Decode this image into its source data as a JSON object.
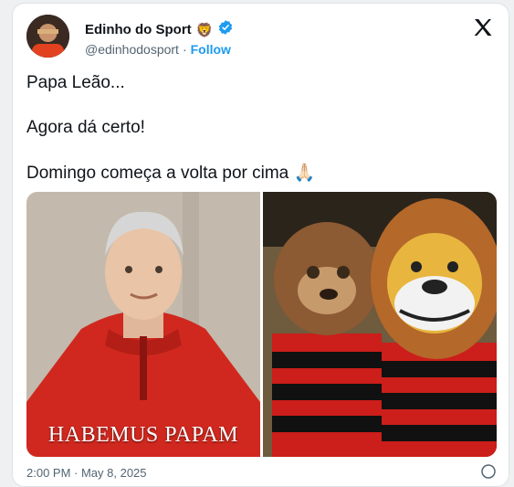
{
  "tweet": {
    "author_name": "Edinho do Sport",
    "name_emoji": "🦁",
    "handle": "@edinhodosport",
    "separator": "·",
    "follow_label": "Follow",
    "lines": [
      "Papa Leão...",
      "Agora dá certo!",
      "Domingo começa a volta por cima"
    ],
    "line3_emoji": "🙏🏻",
    "timestamp": "2:00 PM · May 8, 2025"
  },
  "media": {
    "left_caption": "HABEMUS PAPAM"
  },
  "colors": {
    "accent": "#1d9bf0",
    "text": "#0f1419",
    "muted": "#536471"
  }
}
